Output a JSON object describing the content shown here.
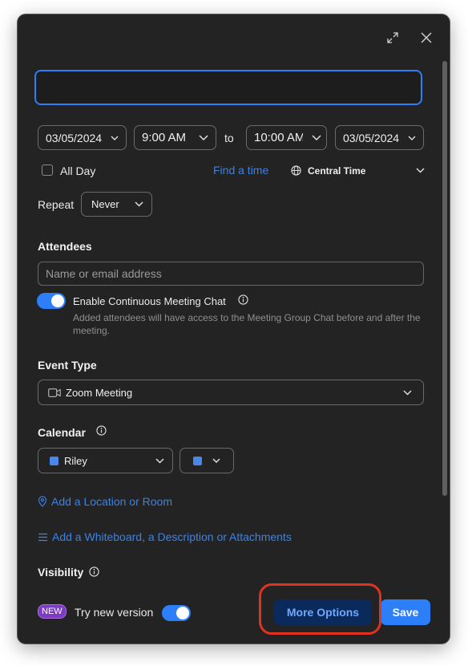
{
  "title_field": {
    "value": "",
    "placeholder": ""
  },
  "datetime": {
    "start_date": "03/05/2024",
    "start_time": "9:00 AM",
    "separator": "to",
    "end_time": "10:00 AM",
    "end_date": "03/05/2024"
  },
  "all_day": {
    "label": "All Day",
    "checked": false
  },
  "find_time_label": "Find a time",
  "timezone": "Central Time",
  "repeat": {
    "label": "Repeat",
    "value": "Never"
  },
  "attendees": {
    "heading": "Attendees",
    "placeholder": "Name or email address",
    "chat_toggle_label": "Enable Continuous Meeting Chat",
    "chat_note": "Added attendees will have access to the Meeting Group Chat before and after the meeting."
  },
  "event_type": {
    "heading": "Event Type",
    "value": "Zoom Meeting"
  },
  "calendar": {
    "heading": "Calendar",
    "value": "Riley",
    "color": "#4a86e8"
  },
  "add_location_label": "Add a Location or Room",
  "add_whiteboard_label": "Add a Whiteboard, a Description or Attachments",
  "visibility_heading": "Visibility",
  "footer": {
    "new_badge": "NEW",
    "try_new_label": "Try new version",
    "more_options_label": "More Options",
    "save_label": "Save"
  },
  "colors": {
    "accent": "#2d7ff9",
    "link": "#3b82e6",
    "background": "#232323",
    "highlight": "#e2321f"
  }
}
